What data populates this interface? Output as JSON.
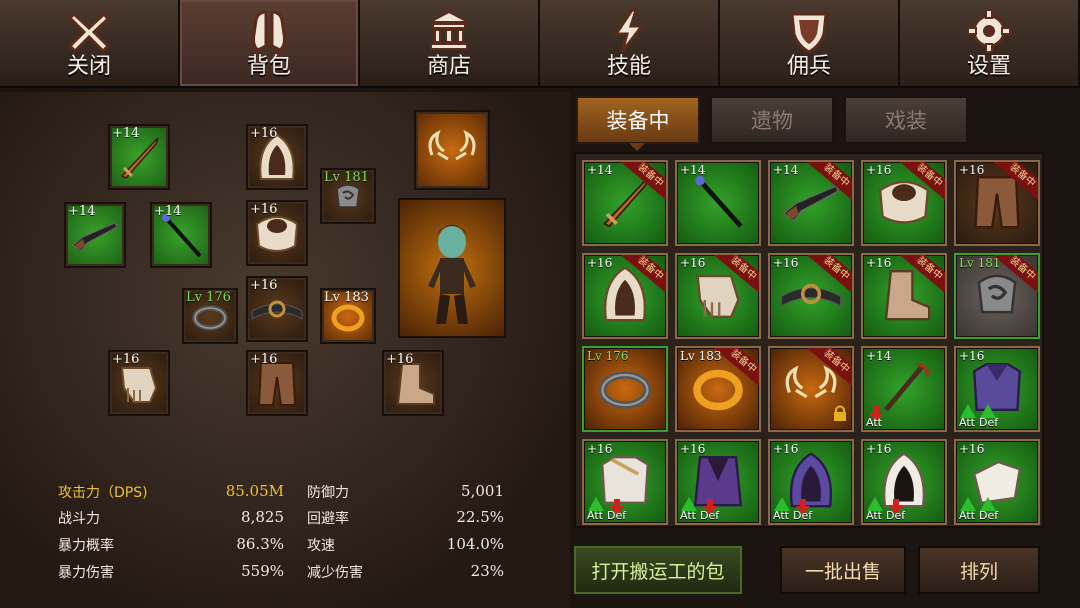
{
  "nav": {
    "items": [
      {
        "label": "关闭",
        "icon": "close-icon"
      },
      {
        "label": "背包",
        "icon": "backpack-icon"
      },
      {
        "label": "商店",
        "icon": "shop-icon"
      },
      {
        "label": "技能",
        "icon": "lightning-icon"
      },
      {
        "label": "佣兵",
        "icon": "shield-icon"
      },
      {
        "label": "设置",
        "icon": "gear-icon"
      }
    ],
    "active_index": 1
  },
  "equip_slots": {
    "sword": "+14",
    "rifle": "+14",
    "staff": "+14",
    "hood": "+16",
    "shoulders": "+16",
    "relic": "Lv 181",
    "ring1": "Lv 176",
    "belt": "+16",
    "ring2": "Lv 183",
    "gloves": "+16",
    "pants": "+16",
    "boots": "+16"
  },
  "stats": {
    "left": [
      {
        "label": "攻击力（DPS)",
        "value": "85.05M",
        "highlight": true
      },
      {
        "label": "战斗力",
        "value": "8,825"
      },
      {
        "label": "暴力概率",
        "value": "86.3%"
      },
      {
        "label": "暴力伤害",
        "value": "559%"
      }
    ],
    "right": [
      {
        "label": "防御力",
        "value": "5,001"
      },
      {
        "label": "回避率",
        "value": "22.5%"
      },
      {
        "label": "攻速",
        "value": "104.0%"
      },
      {
        "label": "减少伤害",
        "value": "23%"
      }
    ]
  },
  "tabs": [
    "装备中",
    "遗物",
    "戏装"
  ],
  "active_tab": 0,
  "equipped_tag": "装备中",
  "compare": {
    "att": "Att",
    "def": "Def"
  },
  "inventory": [
    {
      "label": "+14",
      "item": "sword",
      "bg": "green",
      "equipped": true
    },
    {
      "label": "+14",
      "item": "staff",
      "bg": "green",
      "equipped": false
    },
    {
      "label": "+14",
      "item": "rifle",
      "bg": "green",
      "equipped": true
    },
    {
      "label": "+16",
      "item": "shoulders",
      "bg": "green",
      "equipped": true
    },
    {
      "label": "+16",
      "item": "pants",
      "bg": "brown",
      "equipped": true
    },
    {
      "label": "+16",
      "item": "hood",
      "bg": "green",
      "equipped": true
    },
    {
      "label": "+16",
      "item": "gloves",
      "bg": "green",
      "equipped": true
    },
    {
      "label": "+16",
      "item": "belt",
      "bg": "green",
      "equipped": true
    },
    {
      "label": "+16",
      "item": "boots",
      "bg": "green",
      "equipped": true
    },
    {
      "label": "Lv 181",
      "item": "relic",
      "bg": "gray",
      "equipped": true,
      "lv": true
    },
    {
      "label": "Lv 176",
      "item": "ring-dark",
      "bg": "orange",
      "equipped": false,
      "lv": true
    },
    {
      "label": "Lv 183",
      "item": "ring-gold",
      "bg": "orange",
      "equipped": true,
      "lvw": true
    },
    {
      "label": "",
      "item": "horns",
      "bg": "orange",
      "equipped": true,
      "lock": true
    },
    {
      "label": "+14",
      "item": "scepter",
      "bg": "green",
      "equipped": false,
      "cmp": [
        "down"
      ],
      "cmpText": "att"
    },
    {
      "label": "+16",
      "item": "armor-purple",
      "bg": "green",
      "equipped": false,
      "cmp": [
        "up",
        "up"
      ],
      "cmpText": "both"
    },
    {
      "label": "+16",
      "item": "armor-white",
      "bg": "green",
      "equipped": false,
      "cmp": [
        "up",
        "down"
      ],
      "cmpText": "both"
    },
    {
      "label": "+16",
      "item": "cloak-purple",
      "bg": "green",
      "equipped": false,
      "cmp": [
        "up",
        "down"
      ],
      "cmpText": "both"
    },
    {
      "label": "+16",
      "item": "hood-purple",
      "bg": "green",
      "equipped": false,
      "cmp": [
        "up",
        "down"
      ],
      "cmpText": "both"
    },
    {
      "label": "+16",
      "item": "hood-white",
      "bg": "green",
      "equipped": false,
      "cmp": [
        "up",
        "down"
      ],
      "cmpText": "both"
    },
    {
      "label": "+16",
      "item": "glove-white",
      "bg": "green",
      "equipped": false,
      "cmp": [
        "up",
        "up"
      ],
      "cmpText": "both"
    }
  ],
  "buttons": {
    "open_porter": "打开搬运工的包",
    "bulk_sell": "一批出售",
    "sort": "排列"
  }
}
